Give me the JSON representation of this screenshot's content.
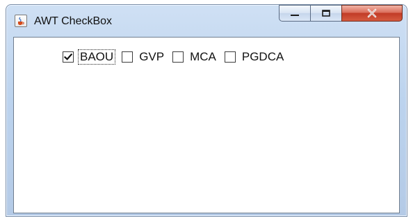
{
  "window": {
    "title": "AWT CheckBox",
    "icon": "java-cup-icon",
    "controls": {
      "minimize_icon": "minimize-icon",
      "maximize_icon": "maximize-icon",
      "close_icon": "close-icon"
    }
  },
  "checkboxes": [
    {
      "label": "BAOU",
      "checked": true,
      "focused": true
    },
    {
      "label": "GVP",
      "checked": false,
      "focused": false
    },
    {
      "label": "MCA",
      "checked": false,
      "focused": false
    },
    {
      "label": "PGDCA",
      "checked": false,
      "focused": false
    }
  ],
  "colors": {
    "close_button": "#c13c27",
    "titlebar": "#bcd3ee",
    "client_background": "#ffffff"
  }
}
